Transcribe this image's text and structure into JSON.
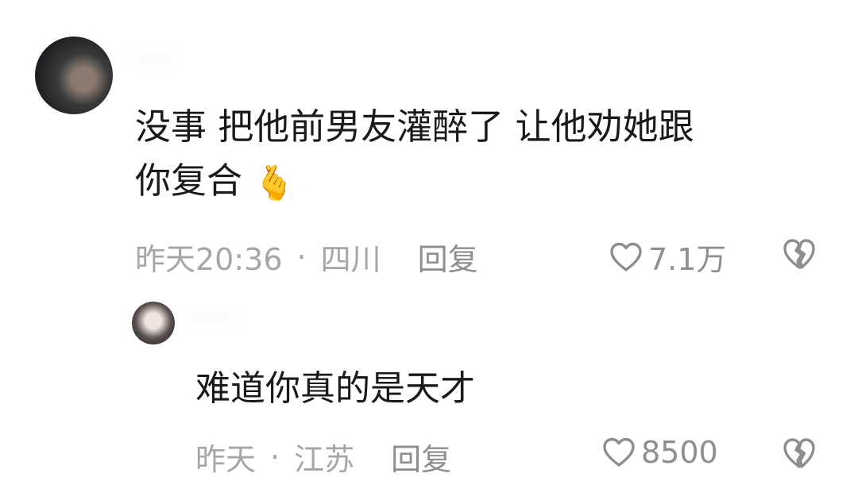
{
  "comments": [
    {
      "username": "——",
      "text_line1": "没事 把他前男友灌醉了 让他劝她跟",
      "text_line2": "你复合",
      "emoji": "🫰",
      "time": "昨天20:36",
      "separator": "·",
      "location": "四川",
      "reply_label": "回复",
      "likes": "7.1万"
    },
    {
      "username": "——",
      "text_line1": "难道你真的是天才",
      "time": "昨天",
      "separator": "·",
      "location": "江苏",
      "reply_label": "回复",
      "likes": "8500"
    }
  ],
  "colors": {
    "text": "#1a1a1a",
    "meta": "#a6a6a6",
    "icon": "#8e8e8e",
    "heart_emoji": "#f04f6a"
  }
}
